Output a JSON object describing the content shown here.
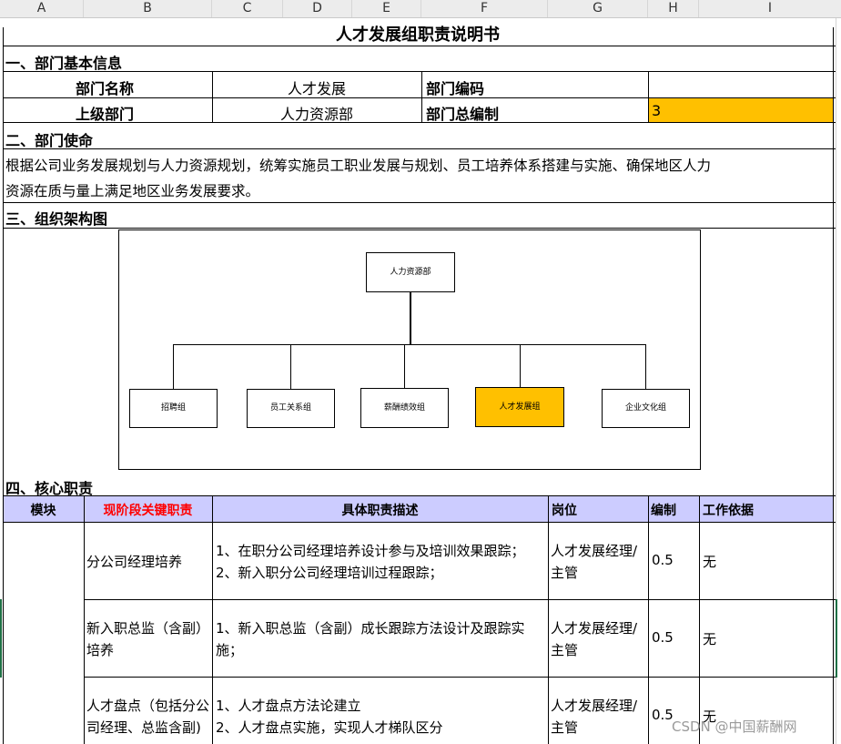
{
  "columns": [
    "A",
    "B",
    "C",
    "D",
    "E",
    "F",
    "G",
    "H",
    "I"
  ],
  "title": "人才发展组职责说明书",
  "section1": {
    "heading": "一、部门基本信息",
    "dept_name_label": "部门名称",
    "dept_name_value": "人才发展",
    "dept_code_label": "部门编码",
    "dept_code_value": "",
    "parent_label": "上级部门",
    "parent_value": "人力资源部",
    "headcount_label": "部门总编制",
    "headcount_value": "3"
  },
  "section2": {
    "heading": "二、部门使命",
    "mission_line1": "根据公司业务发展规划与人力资源规划，统筹实施员工职业发展与规划、员工培养体系搭建与实施、确保地区人力",
    "mission_line2": "资源在质与量上满足地区业务发展要求。"
  },
  "section3": {
    "heading": "三、组织架构图",
    "org_root": "人力资源部",
    "org_children": [
      "招聘组",
      "员工关系组",
      "薪酬绩效组",
      "人才发展组",
      "企业文化组"
    ],
    "highlight_color": "#ffc000"
  },
  "section4": {
    "heading": "四、核心职责",
    "headers": {
      "module": "模块",
      "key_duty": "现阶段关键职责",
      "description": "具体职责描述",
      "position": "岗位",
      "headcount": "编制",
      "basis": "工作依据"
    },
    "header_bg": "#ccccff",
    "key_duty_color": "#ff0000",
    "rows": [
      {
        "key_duty_l1": "分公司经理培养",
        "key_duty_l2": "",
        "desc_l1": "1、在职分公司经理培养设计参与及培训效果跟踪；",
        "desc_l2": "2、新入职分公司经理培训过程跟踪；",
        "pos_l1": "人才发展经理/",
        "pos_l2": "主管",
        "headcount": "0.5",
        "basis": "无"
      },
      {
        "key_duty_l1": "新入职总监（含副）",
        "key_duty_l2": "培养",
        "desc_l1": "1、新入职总监（含副）成长跟踪方法设计及跟踪实",
        "desc_l2": "施；",
        "pos_l1": "人才发展经理/",
        "pos_l2": "主管",
        "headcount": "0.5",
        "basis": "无"
      },
      {
        "key_duty_l1": "人才盘点（包括分公",
        "key_duty_l2": "司经理、总监含副)",
        "desc_l1": "1、人才盘点方法论建立",
        "desc_l2": "2、人才盘点实施，实现人才梯队区分",
        "pos_l1": "人才发展经理/",
        "pos_l2": "主管",
        "headcount": "0.5",
        "basis": "无"
      }
    ]
  },
  "watermark": "CSDN @中国薪酬网"
}
